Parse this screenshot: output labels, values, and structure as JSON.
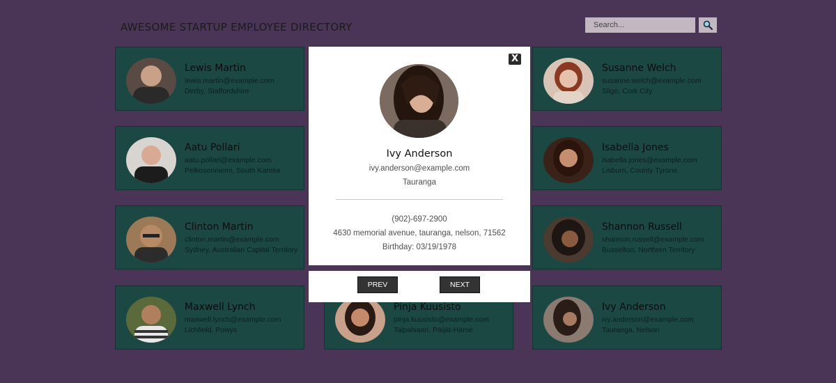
{
  "header": {
    "title": "AWESOME STARTUP EMPLOYEE DIRECTORY",
    "search_placeholder": "Search...",
    "search_icon": "magnifier-icon"
  },
  "employees": [
    {
      "name": "Lewis Martin",
      "email": "lewis.martin@example.com",
      "location": "Derby, Staffordshire"
    },
    {
      "name": "Susanne Welch",
      "email": "susanne.welch@example.com",
      "location": "Sligo, Cork City"
    },
    {
      "name": "Aatu Pollari",
      "email": "aatu.pollari@example.com",
      "location": "Pelkosenniemi, South Karelia"
    },
    {
      "name": "Isabella Jones",
      "email": "isabella.jones@example.com",
      "location": "Lisburn, County Tyrone"
    },
    {
      "name": "Clinton Martin",
      "email": "clinton.martin@example.com",
      "location": "Sydney, Australian Capital Territory"
    },
    {
      "name": "Shannon Russell",
      "email": "shannon.russell@example.com",
      "location": "Busselton, Northern Territory"
    },
    {
      "name": "Maxwell Lynch",
      "email": "maxwell.lynch@example.com",
      "location": "Lichfield, Powys"
    },
    {
      "name": "Pinja Kuusisto",
      "email": "pinja.kuusisto@example.com",
      "location": "Taipalsaari, Päijät-Häme"
    },
    {
      "name": "Ivy Anderson",
      "email": "ivy.anderson@example.com",
      "location": "Tauranga, Nelson"
    }
  ],
  "modal": {
    "close_label": "X",
    "name": "Ivy Anderson",
    "email": "ivy.anderson@example.com",
    "city": "Tauranga",
    "phone": "(902)-697-2900",
    "address": "4630 memorial avenue, tauranga, nelson, 71562",
    "birthday": "Birthday: 03/19/1978"
  },
  "nav": {
    "prev_label": "PREV",
    "next_label": "NEXT"
  },
  "colors": {
    "background": "#4a3556",
    "card": "#1c4844",
    "modal": "#ffffff",
    "button": "#333333"
  }
}
